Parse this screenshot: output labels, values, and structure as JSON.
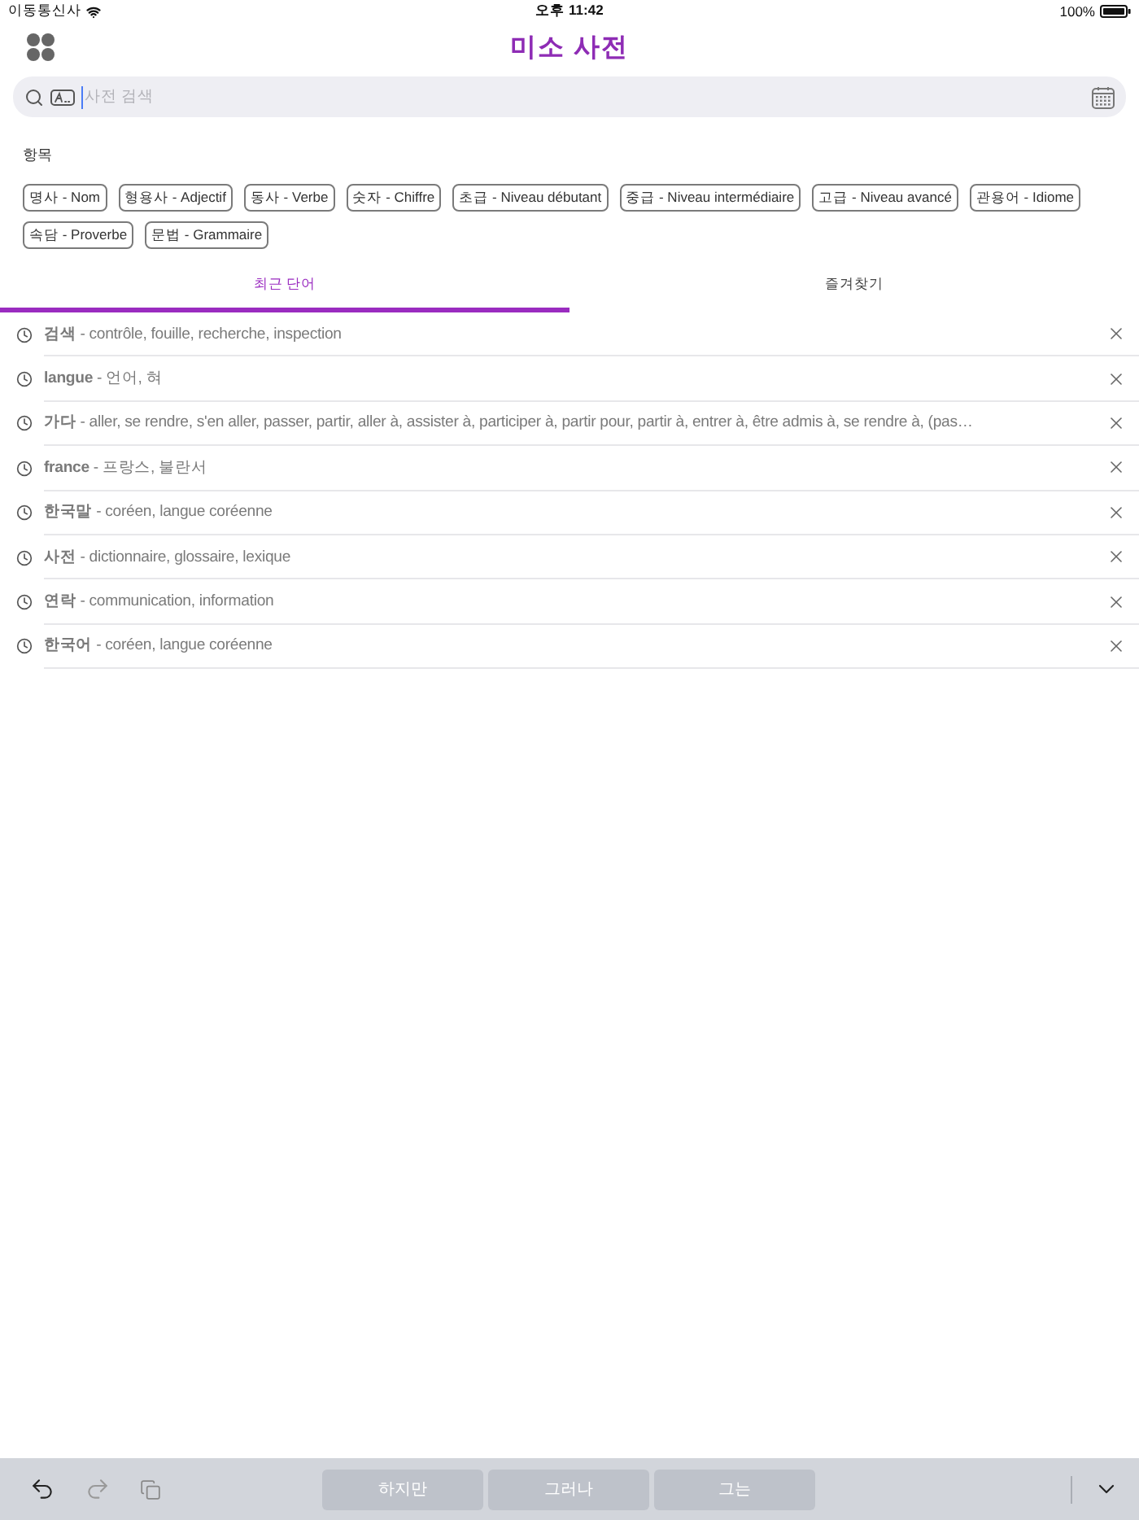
{
  "status_bar": {
    "carrier": "이동통신사",
    "time": "오후 11:42",
    "battery": "100%"
  },
  "header": {
    "title": "미소 사전"
  },
  "search": {
    "placeholder": "사전 검색"
  },
  "categories": {
    "label": "항목",
    "chips": [
      "명사 - Nom",
      "형용사 - Adjectif",
      "동사 - Verbe",
      "숫자 - Chiffre",
      "초급 - Niveau débutant",
      "중급 - Niveau intermédiaire",
      "고급 - Niveau avancé",
      "관용어 - Idiome",
      "속담 - Proverbe",
      "문법 - Grammaire"
    ]
  },
  "tabs": [
    {
      "label": "최근 단어",
      "selected": true
    },
    {
      "label": "즐겨찾기",
      "selected": false
    }
  ],
  "recent_words": [
    {
      "text": "**검색** - contrôle, fouille, recherche, inspection"
    },
    {
      "text": "**langue** - 언어, 혀"
    },
    {
      "text": "**가다** - aller, se rendre, s'en aller, passer, partir, aller à, assister à, participer à, partir pour, partir à, entrer à, être admis à, se rendre à, (pas…"
    },
    {
      "text": "**france** - 프랑스, 불란서"
    },
    {
      "text": "**한국말** - coréen, langue coréenne"
    },
    {
      "text": "**사전** - dictionnaire, glossaire, lexique"
    },
    {
      "text": "**연락** - communication, information"
    },
    {
      "text": "**한국어** - coréen, langue coréenne"
    }
  ],
  "keyboard_bar": {
    "suggestions": [
      "하지만",
      "그러나",
      "그는"
    ]
  }
}
